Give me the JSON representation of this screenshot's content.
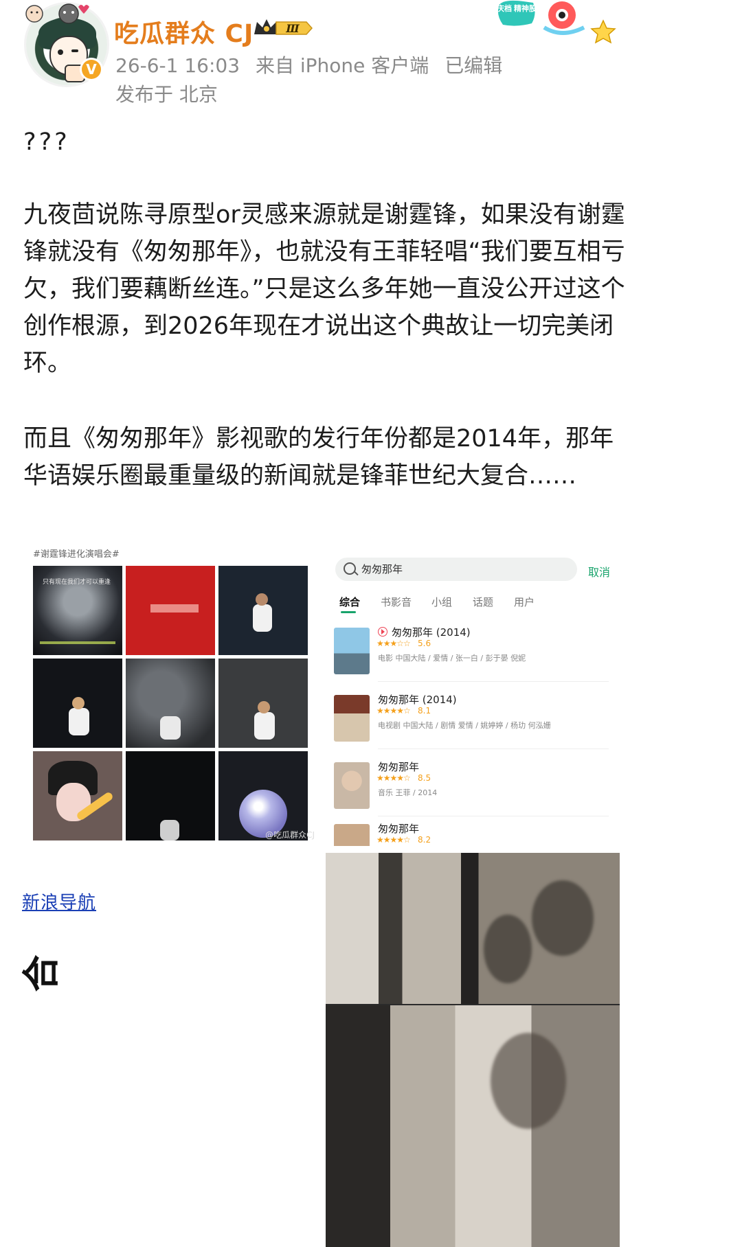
{
  "header": {
    "username": "吃瓜群众 CJ",
    "vip_level": "Ⅲ",
    "verify_mark": "V",
    "date": "26-6-1 16:03",
    "source": "来自 iPhone 客户端",
    "edited": "已编辑",
    "location": "发布于 北京",
    "promo_text": "国庆档 精神股东"
  },
  "post": {
    "line_q": "???",
    "paragraph_1": "九夜茴说陈寻原型or灵感来源就是谢霆锋，如果没有谢霆锋就没有《匆匆那年》，也就没有王菲轻唱“我们要互相亏欠，我们要藕断丝连。”只是这么多年她一直没公开过这个创作根源，到2026年现在才说出这个典故让一切完美闭环。",
    "paragraph_2": "而且《匆匆那年》影视歌的发行年份都是2014年，那年华语娱乐圈最重量级的新闻就是锋菲世纪大复合……"
  },
  "collage": {
    "caption": "#谢霆锋进化演唱会#",
    "tile_text": "只有现在我们才可以重逢",
    "watermark": "@吃瓜群众CJ"
  },
  "search": {
    "query": "匆匆那年",
    "cancel": "取消",
    "tabs": [
      "综合",
      "书影音",
      "小组",
      "话题",
      "用户"
    ],
    "results": [
      {
        "title": "匆匆那年 (2014)",
        "stars": "★★★☆☆",
        "rating": "5.6",
        "info": "电影  中国大陆 / 爱情 / 张一白 / 彭于晏 倪妮"
      },
      {
        "title": "匆匆那年 (2014)",
        "stars": "★★★★☆",
        "rating": "8.1",
        "info": "电视剧  中国大陆 / 剧情 爱情 / 姚婷婷 / 杨玏 何泓姗"
      },
      {
        "title": "匆匆那年",
        "stars": "★★★★☆",
        "rating": "8.5",
        "info": "音乐  王菲 / 2014"
      },
      {
        "title": "匆匆那年",
        "stars": "★★★★☆",
        "rating": "8.2",
        "info": ""
      }
    ]
  },
  "fragments": {
    "sina_nav": "新浪导航",
    "char": "合"
  },
  "colors": {
    "username": "#e47d1d",
    "meta": "#8a8a8a",
    "accent_green": "#17a36b",
    "link_blue": "#1a3fb5",
    "star_orange": "#f4a01c"
  }
}
